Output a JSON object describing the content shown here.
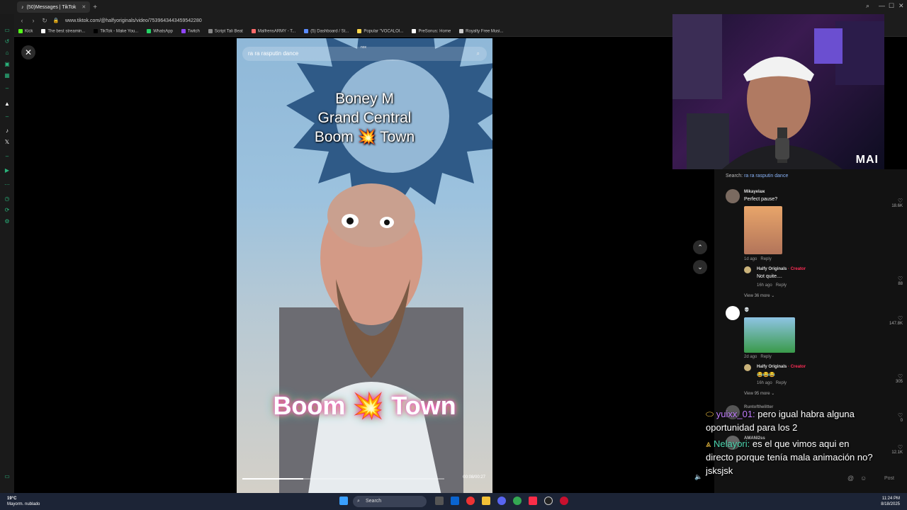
{
  "browser": {
    "tab_title": "(50)Messages | TikTok",
    "url": "www.tiktok.com/@halfyoriginals/video/7539643443459542280",
    "bookmarks": [
      {
        "label": "Kick",
        "color": "#53fc18"
      },
      {
        "label": "The best streamin...",
        "color": "#ffffff"
      },
      {
        "label": "TikTok - Make You...",
        "color": "#000000"
      },
      {
        "label": "WhatsApp",
        "color": "#25d366"
      },
      {
        "label": "Twitch",
        "color": "#9146ff"
      },
      {
        "label": "Script Tali Beat",
        "color": "#888888"
      },
      {
        "label": "MalfrensARMY - T...",
        "color": "#ff6b6b"
      },
      {
        "label": "(5) Dashboard / St...",
        "color": "#5b8cff"
      },
      {
        "label": "Popular \"VOCALOI...",
        "color": "#ffd84d"
      },
      {
        "label": "PreSonus: Home",
        "color": "#ffffff"
      },
      {
        "label": "Royalty Free Musi...",
        "color": "#cccccc"
      }
    ]
  },
  "video": {
    "search_text": "ra ra rasputin dance",
    "watermark": "nox",
    "title_lines": [
      "Boney M",
      "Grand Central",
      "Boom 💥 Town"
    ],
    "caption": "Boom 💥 Town",
    "timecode": "00:08/00:27",
    "progress": 0.3
  },
  "webcam": {
    "label": "MAI"
  },
  "comments": {
    "search_label": "Search:",
    "search_query": "ra ra rasputin dance",
    "items": [
      {
        "user": "Mikayelаж",
        "text": "Perfect pause?",
        "meta_time": "1d ago",
        "meta_reply": "Reply",
        "likes": "18.6K",
        "reply_user": "Halfy Originals",
        "reply_creator": "· Creator",
        "reply_text": "Not quite....",
        "reply_time": "16h ago",
        "reply_reply": "Reply",
        "reply_likes": "88",
        "view_more": "View 36 more"
      },
      {
        "user": "💀",
        "text": "",
        "meta_time": "2d ago",
        "meta_reply": "Reply",
        "likes": "147.8K",
        "reply_user": "Halfy Originals",
        "reply_creator": "· Creator",
        "reply_text": "😂😂😂",
        "reply_time": "16h ago",
        "reply_reply": "Reply",
        "reply_likes": "305",
        "view_more": "View 95 more"
      },
      {
        "user": "Runtofthelitter",
        "likes": "0"
      },
      {
        "user": "AMANI2ss",
        "likes": "12.1K"
      }
    ],
    "post_label": "Post"
  },
  "chat": [
    {
      "user": "yuixx_01:",
      "text": "pero igual habra alguna oportunidad para los 2"
    },
    {
      "user": "Nelayori:",
      "text": "es el que vimos aqui en directo porque tenía mala animación no? jsksjsk"
    }
  ],
  "taskbar": {
    "temperature": "19°C",
    "weather": "Mayorm. nublado",
    "search": "Search",
    "time": "11:24 PM",
    "date": "8/18/2025"
  }
}
